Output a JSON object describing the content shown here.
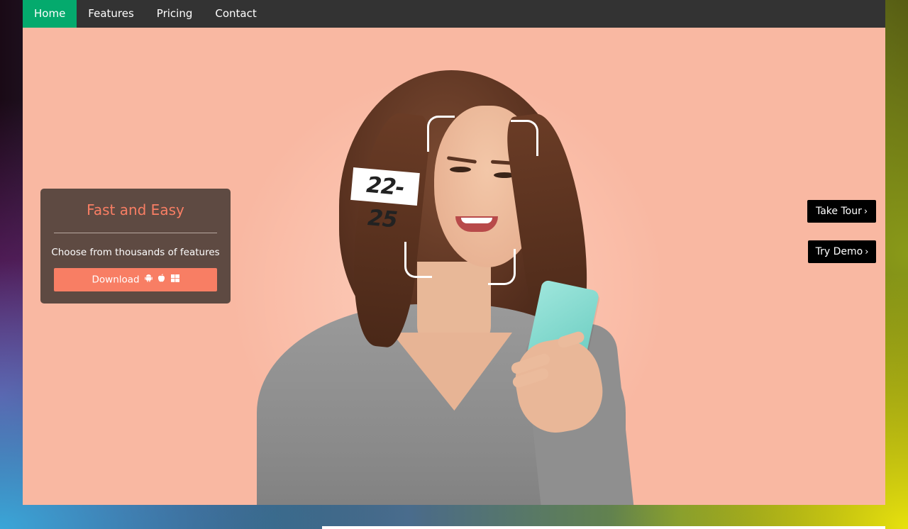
{
  "nav": {
    "items": [
      {
        "label": "Home",
        "active": true
      },
      {
        "label": "Features",
        "active": false
      },
      {
        "label": "Pricing",
        "active": false
      },
      {
        "label": "Contact",
        "active": false
      }
    ]
  },
  "hero": {
    "age_tag": "22-25",
    "image_alt": "woman-looking-at-phone"
  },
  "card": {
    "title": "Fast and Easy",
    "text": "Choose from thousands of features",
    "download_label": "Download",
    "download_icons": [
      "android-icon",
      "apple-icon",
      "windows-icon"
    ]
  },
  "side_buttons": {
    "tour_label": "Take Tour",
    "demo_label": "Try Demo",
    "chevron": "›"
  },
  "colors": {
    "nav_bg": "#333333",
    "nav_active": "#04aa6d",
    "page_bg": "#f9b8a2",
    "card_bg": "#5e4a42",
    "accent": "#f87e64",
    "button_bg": "#000000"
  }
}
